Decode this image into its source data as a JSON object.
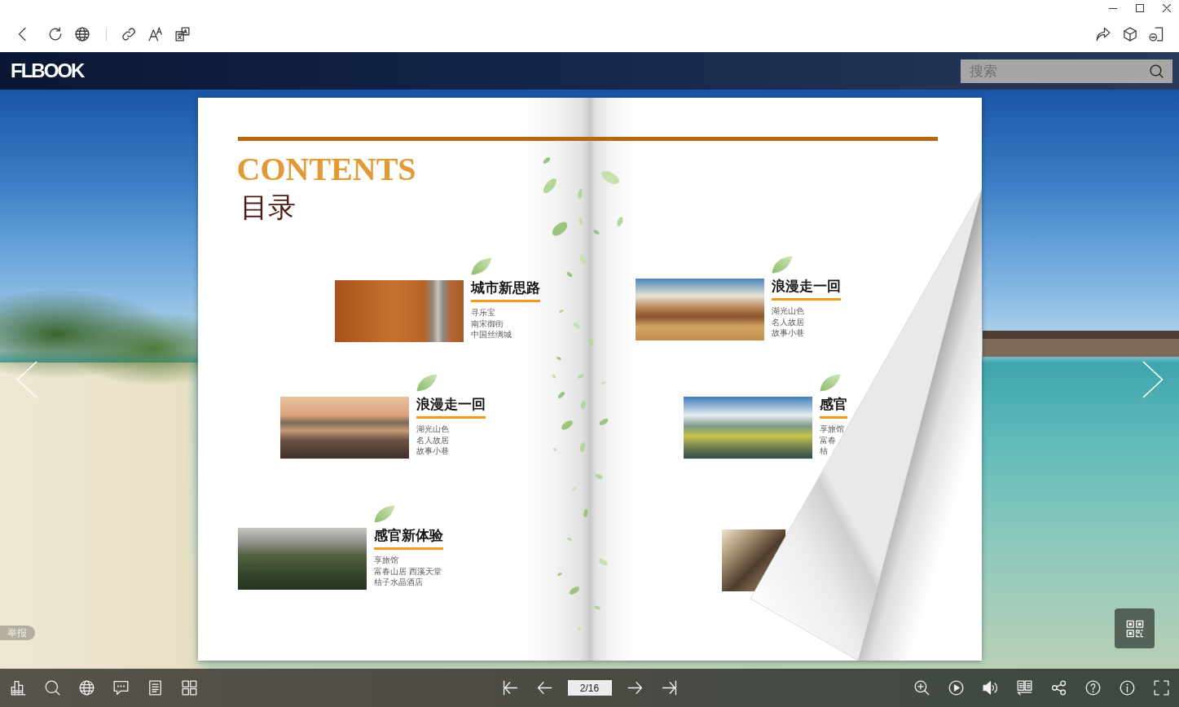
{
  "header": {
    "logo": "FLBOOK",
    "search": {
      "placeholder": "搜索"
    }
  },
  "book": {
    "left_page": {
      "heading": "CONTENTS",
      "subheading": "目录",
      "items": [
        {
          "kind": "entry",
          "title": "城市新思路",
          "lines": [
            "寻乐宝",
            "南宋御街",
            "中国丝绸城"
          ]
        },
        {
          "kind": "entry",
          "title": "浪漫走一回",
          "lines": [
            "湖光山色",
            "名人故居",
            "故事小巷"
          ]
        },
        {
          "kind": "entry",
          "title": "感官新体验",
          "lines": [
            "享旅馆",
            "富春山居 西溪天堂",
            "桔子水晶酒店"
          ]
        }
      ]
    },
    "right_page": {
      "items": [
        {
          "kind": "entry",
          "title": "浪漫走一回",
          "lines": [
            "湖光山色",
            "名人故居",
            "故事小巷"
          ]
        },
        {
          "kind": "entry",
          "title": "感官",
          "lines": [
            "享旅馆",
            "富春",
            "桔"
          ]
        },
        {
          "kind": "photo"
        }
      ]
    }
  },
  "report_button": "举报",
  "bottom_bar": {
    "page_field": {
      "value": "2/16"
    }
  }
}
